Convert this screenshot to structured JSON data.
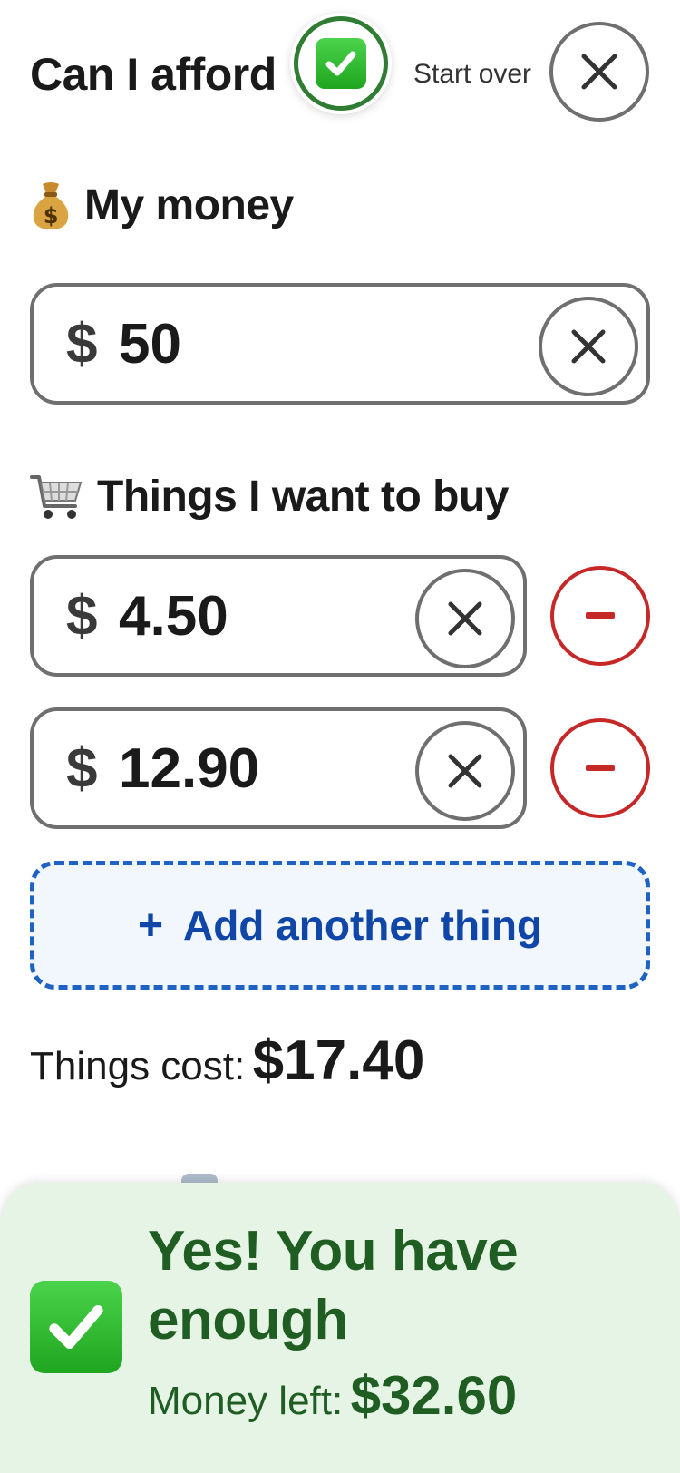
{
  "header": {
    "title": "Can I afford",
    "start_over_label": "Start over",
    "icons": {
      "status_badge": "check-mark-icon",
      "start_over": "close-icon"
    }
  },
  "money": {
    "heading": "My money",
    "heading_icon": "money-bag-icon",
    "currency": "$",
    "value": "50"
  },
  "things": {
    "heading": "Things I want to buy",
    "heading_icon": "shopping-cart-icon",
    "items": [
      {
        "currency": "$",
        "value": "4.50"
      },
      {
        "currency": "$",
        "value": "12.90"
      }
    ],
    "add_label": "Add another thing",
    "add_icon": "+"
  },
  "total": {
    "label": "Things cost:",
    "value": "$17.40"
  },
  "result": {
    "title": "Yes! You have enough",
    "left_label": "Money left:",
    "left_value": "$32.60",
    "icon": "check-mark-icon"
  },
  "colors": {
    "success_text": "#1f5d23",
    "success_bg": "#e6f4e6",
    "add_blue": "#0f46a8",
    "remove_red": "#c62828",
    "border_gray": "#6f6f6f"
  }
}
